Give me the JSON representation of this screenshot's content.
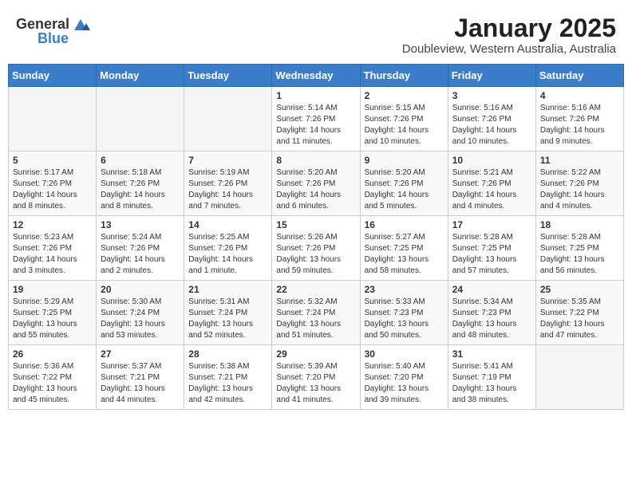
{
  "header": {
    "logo_general": "General",
    "logo_blue": "Blue",
    "month": "January 2025",
    "location": "Doubleview, Western Australia, Australia"
  },
  "days_of_week": [
    "Sunday",
    "Monday",
    "Tuesday",
    "Wednesday",
    "Thursday",
    "Friday",
    "Saturday"
  ],
  "weeks": [
    [
      {
        "day": "",
        "info": ""
      },
      {
        "day": "",
        "info": ""
      },
      {
        "day": "",
        "info": ""
      },
      {
        "day": "1",
        "info": "Sunrise: 5:14 AM\nSunset: 7:26 PM\nDaylight: 14 hours\nand 11 minutes."
      },
      {
        "day": "2",
        "info": "Sunrise: 5:15 AM\nSunset: 7:26 PM\nDaylight: 14 hours\nand 10 minutes."
      },
      {
        "day": "3",
        "info": "Sunrise: 5:16 AM\nSunset: 7:26 PM\nDaylight: 14 hours\nand 10 minutes."
      },
      {
        "day": "4",
        "info": "Sunrise: 5:16 AM\nSunset: 7:26 PM\nDaylight: 14 hours\nand 9 minutes."
      }
    ],
    [
      {
        "day": "5",
        "info": "Sunrise: 5:17 AM\nSunset: 7:26 PM\nDaylight: 14 hours\nand 8 minutes."
      },
      {
        "day": "6",
        "info": "Sunrise: 5:18 AM\nSunset: 7:26 PM\nDaylight: 14 hours\nand 8 minutes."
      },
      {
        "day": "7",
        "info": "Sunrise: 5:19 AM\nSunset: 7:26 PM\nDaylight: 14 hours\nand 7 minutes."
      },
      {
        "day": "8",
        "info": "Sunrise: 5:20 AM\nSunset: 7:26 PM\nDaylight: 14 hours\nand 6 minutes."
      },
      {
        "day": "9",
        "info": "Sunrise: 5:20 AM\nSunset: 7:26 PM\nDaylight: 14 hours\nand 5 minutes."
      },
      {
        "day": "10",
        "info": "Sunrise: 5:21 AM\nSunset: 7:26 PM\nDaylight: 14 hours\nand 4 minutes."
      },
      {
        "day": "11",
        "info": "Sunrise: 5:22 AM\nSunset: 7:26 PM\nDaylight: 14 hours\nand 4 minutes."
      }
    ],
    [
      {
        "day": "12",
        "info": "Sunrise: 5:23 AM\nSunset: 7:26 PM\nDaylight: 14 hours\nand 3 minutes."
      },
      {
        "day": "13",
        "info": "Sunrise: 5:24 AM\nSunset: 7:26 PM\nDaylight: 14 hours\nand 2 minutes."
      },
      {
        "day": "14",
        "info": "Sunrise: 5:25 AM\nSunset: 7:26 PM\nDaylight: 14 hours\nand 1 minute."
      },
      {
        "day": "15",
        "info": "Sunrise: 5:26 AM\nSunset: 7:26 PM\nDaylight: 13 hours\nand 59 minutes."
      },
      {
        "day": "16",
        "info": "Sunrise: 5:27 AM\nSunset: 7:25 PM\nDaylight: 13 hours\nand 58 minutes."
      },
      {
        "day": "17",
        "info": "Sunrise: 5:28 AM\nSunset: 7:25 PM\nDaylight: 13 hours\nand 57 minutes."
      },
      {
        "day": "18",
        "info": "Sunrise: 5:28 AM\nSunset: 7:25 PM\nDaylight: 13 hours\nand 56 minutes."
      }
    ],
    [
      {
        "day": "19",
        "info": "Sunrise: 5:29 AM\nSunset: 7:25 PM\nDaylight: 13 hours\nand 55 minutes."
      },
      {
        "day": "20",
        "info": "Sunrise: 5:30 AM\nSunset: 7:24 PM\nDaylight: 13 hours\nand 53 minutes."
      },
      {
        "day": "21",
        "info": "Sunrise: 5:31 AM\nSunset: 7:24 PM\nDaylight: 13 hours\nand 52 minutes."
      },
      {
        "day": "22",
        "info": "Sunrise: 5:32 AM\nSunset: 7:24 PM\nDaylight: 13 hours\nand 51 minutes."
      },
      {
        "day": "23",
        "info": "Sunrise: 5:33 AM\nSunset: 7:23 PM\nDaylight: 13 hours\nand 50 minutes."
      },
      {
        "day": "24",
        "info": "Sunrise: 5:34 AM\nSunset: 7:23 PM\nDaylight: 13 hours\nand 48 minutes."
      },
      {
        "day": "25",
        "info": "Sunrise: 5:35 AM\nSunset: 7:22 PM\nDaylight: 13 hours\nand 47 minutes."
      }
    ],
    [
      {
        "day": "26",
        "info": "Sunrise: 5:36 AM\nSunset: 7:22 PM\nDaylight: 13 hours\nand 45 minutes."
      },
      {
        "day": "27",
        "info": "Sunrise: 5:37 AM\nSunset: 7:21 PM\nDaylight: 13 hours\nand 44 minutes."
      },
      {
        "day": "28",
        "info": "Sunrise: 5:38 AM\nSunset: 7:21 PM\nDaylight: 13 hours\nand 42 minutes."
      },
      {
        "day": "29",
        "info": "Sunrise: 5:39 AM\nSunset: 7:20 PM\nDaylight: 13 hours\nand 41 minutes."
      },
      {
        "day": "30",
        "info": "Sunrise: 5:40 AM\nSunset: 7:20 PM\nDaylight: 13 hours\nand 39 minutes."
      },
      {
        "day": "31",
        "info": "Sunrise: 5:41 AM\nSunset: 7:19 PM\nDaylight: 13 hours\nand 38 minutes."
      },
      {
        "day": "",
        "info": ""
      }
    ]
  ]
}
